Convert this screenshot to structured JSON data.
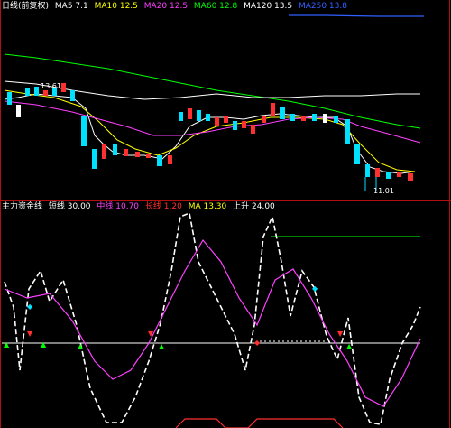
{
  "top_panel": {
    "title": "日线(前复权)",
    "indicators": [
      {
        "label": "MA5 7.1",
        "color": "#ffffff"
      },
      {
        "label": "MA10 12.5",
        "color": "#ffff00"
      },
      {
        "label": "MA20 12.5",
        "color": "#ff40ff"
      },
      {
        "label": "MA60 12.8",
        "color": "#00ff00"
      },
      {
        "label": "MA120 13.5",
        "color": "#ffffff"
      },
      {
        "label": "MA250 13.8",
        "color": "#3060ff"
      }
    ],
    "price_tag": "13.61",
    "low_tag": "11.01"
  },
  "bottom_panel": {
    "title": "主力资金线",
    "indicators": [
      {
        "label": "短线 30.00",
        "color": "#ffffff"
      },
      {
        "label": "中线 10.70",
        "color": "#ff40ff"
      },
      {
        "label": "长线 1.20",
        "color": "#ff3030"
      },
      {
        "label": "MA 13.30",
        "color": "#ffff00"
      },
      {
        "label": "上升 24.00",
        "color": "#ffffff"
      }
    ]
  },
  "colors": {
    "bull": "#ff3030",
    "bear": "#00e0ff",
    "border": "#b01010",
    "white_line": "#ffffff",
    "magenta_line": "#ff40ff",
    "green_line": "#00ff00"
  }
}
